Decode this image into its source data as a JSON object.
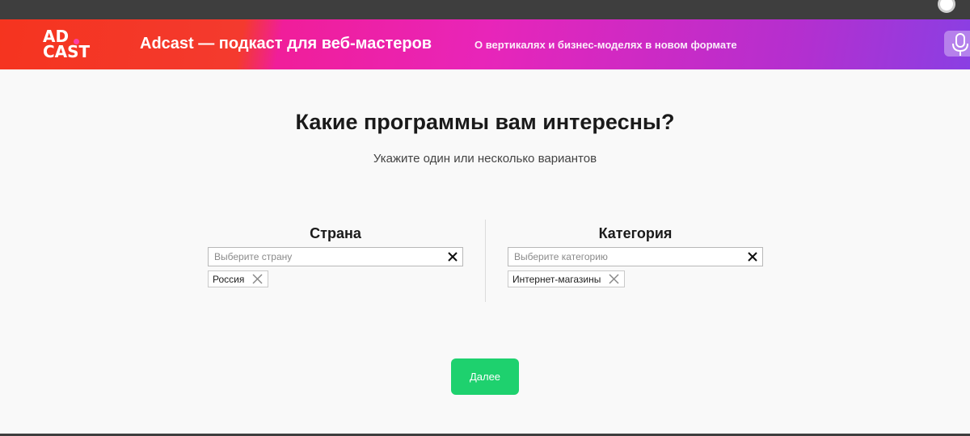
{
  "banner": {
    "logo_line1": "AD",
    "logo_line2": "CAST",
    "title": "Adcast — подкаст для веб-мастеров",
    "subtitle": "О вертикалях и бизнес-моделях в новом формате",
    "mic_icon": "microphone-icon"
  },
  "form": {
    "question": "Какие программы вам интересны?",
    "hint": "Укажите один или несколько вариантов",
    "country": {
      "title": "Страна",
      "placeholder": "Выберите страну",
      "value": "",
      "selected": [
        "Россия"
      ]
    },
    "category": {
      "title": "Категория",
      "placeholder": "Выберите категорию",
      "value": "",
      "selected": [
        "Интернет-магазины"
      ]
    },
    "next_label": "Далее"
  },
  "colors": {
    "banner_red": "#f5341f",
    "banner_pink": "#f01e9a",
    "banner_purple": "#8a3fe3",
    "button_green": "#1ed16e",
    "topbar": "#3e3e3e"
  }
}
